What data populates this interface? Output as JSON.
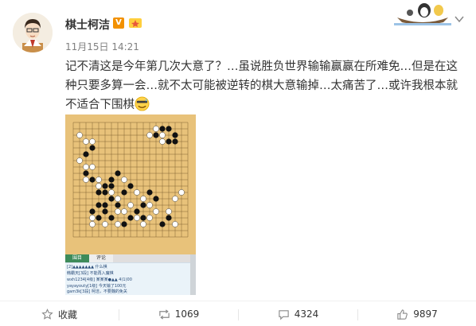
{
  "post": {
    "username": "棋士柯洁",
    "vip_badge": "V",
    "timestamp": "11月15日 14:21",
    "text": "记不清这是今年第几次大意了？…虽说胜负世界输输赢赢在所难免…但是在这种只要多算一会…就不太可能被逆转的棋大意输掉…太痛苦了…或许我根本就不适合下围棋",
    "emoji_name": "sweat-smile-emoji"
  },
  "screenshot": {
    "tabs": [
      "围目",
      "评论"
    ],
    "chat_lines": [
      "[2]▲▲▲▲▲▲▲ 什么棋",
      "韩霸天[3段] 不能再入魔棋",
      "wxh1234[4级] 某某某●▲▲ 4(1)00",
      "yayayouty[1级] 今天输了100元",
      "gam3k[3段] 柯洁，不要魏的免关"
    ]
  },
  "actions": {
    "favorite": "收藏",
    "repost_count": "1069",
    "comment_count": "4324",
    "like_count": "9897"
  },
  "colors": {
    "board": "#e8c27a",
    "vip": "#f29100",
    "link": "#2a4d7a"
  }
}
